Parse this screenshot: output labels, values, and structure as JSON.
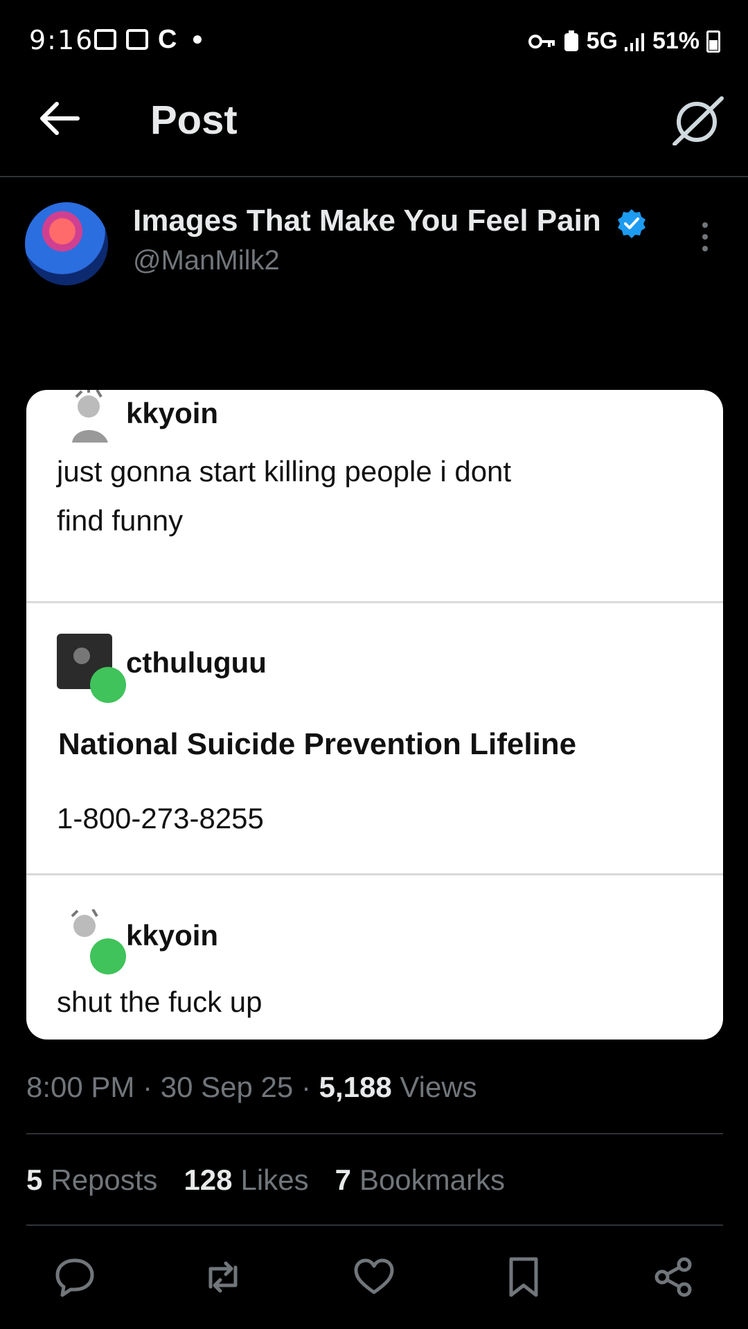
{
  "status_bar": {
    "time": "9:16",
    "network": "5G",
    "battery": "51%"
  },
  "header": {
    "title": "Post"
  },
  "author": {
    "name": "Images That Make You Feel Pain",
    "handle": "@ManMilk2",
    "verified": true
  },
  "embedded_image": {
    "posts": [
      {
        "user": "kkyoin",
        "text_lines": [
          "just gonna start killing people i dont",
          "find funny"
        ]
      },
      {
        "user": "cthuluguu",
        "title": "National Suicide Prevention Lifeline",
        "text": "1-800-273-8255"
      },
      {
        "user": "kkyoin",
        "text": "shut the fuck up"
      }
    ]
  },
  "meta": {
    "time": "8:00 PM",
    "date": "30 Sep 25",
    "views_count": "5,188",
    "views_label": "Views"
  },
  "stats": {
    "reposts_count": "5",
    "reposts_label": "Reposts",
    "likes_count": "128",
    "likes_label": "Likes",
    "bookmarks_count": "7",
    "bookmarks_label": "Bookmarks"
  },
  "actions": [
    "reply-icon",
    "repost-icon",
    "like-icon",
    "bookmark-icon",
    "share-icon"
  ],
  "colors": {
    "background": "#000000",
    "primary_text": "#e7e9ea",
    "secondary_text": "#71767b",
    "verified_blue": "#1d9bf0",
    "reblog_green": "#3fc35a"
  }
}
